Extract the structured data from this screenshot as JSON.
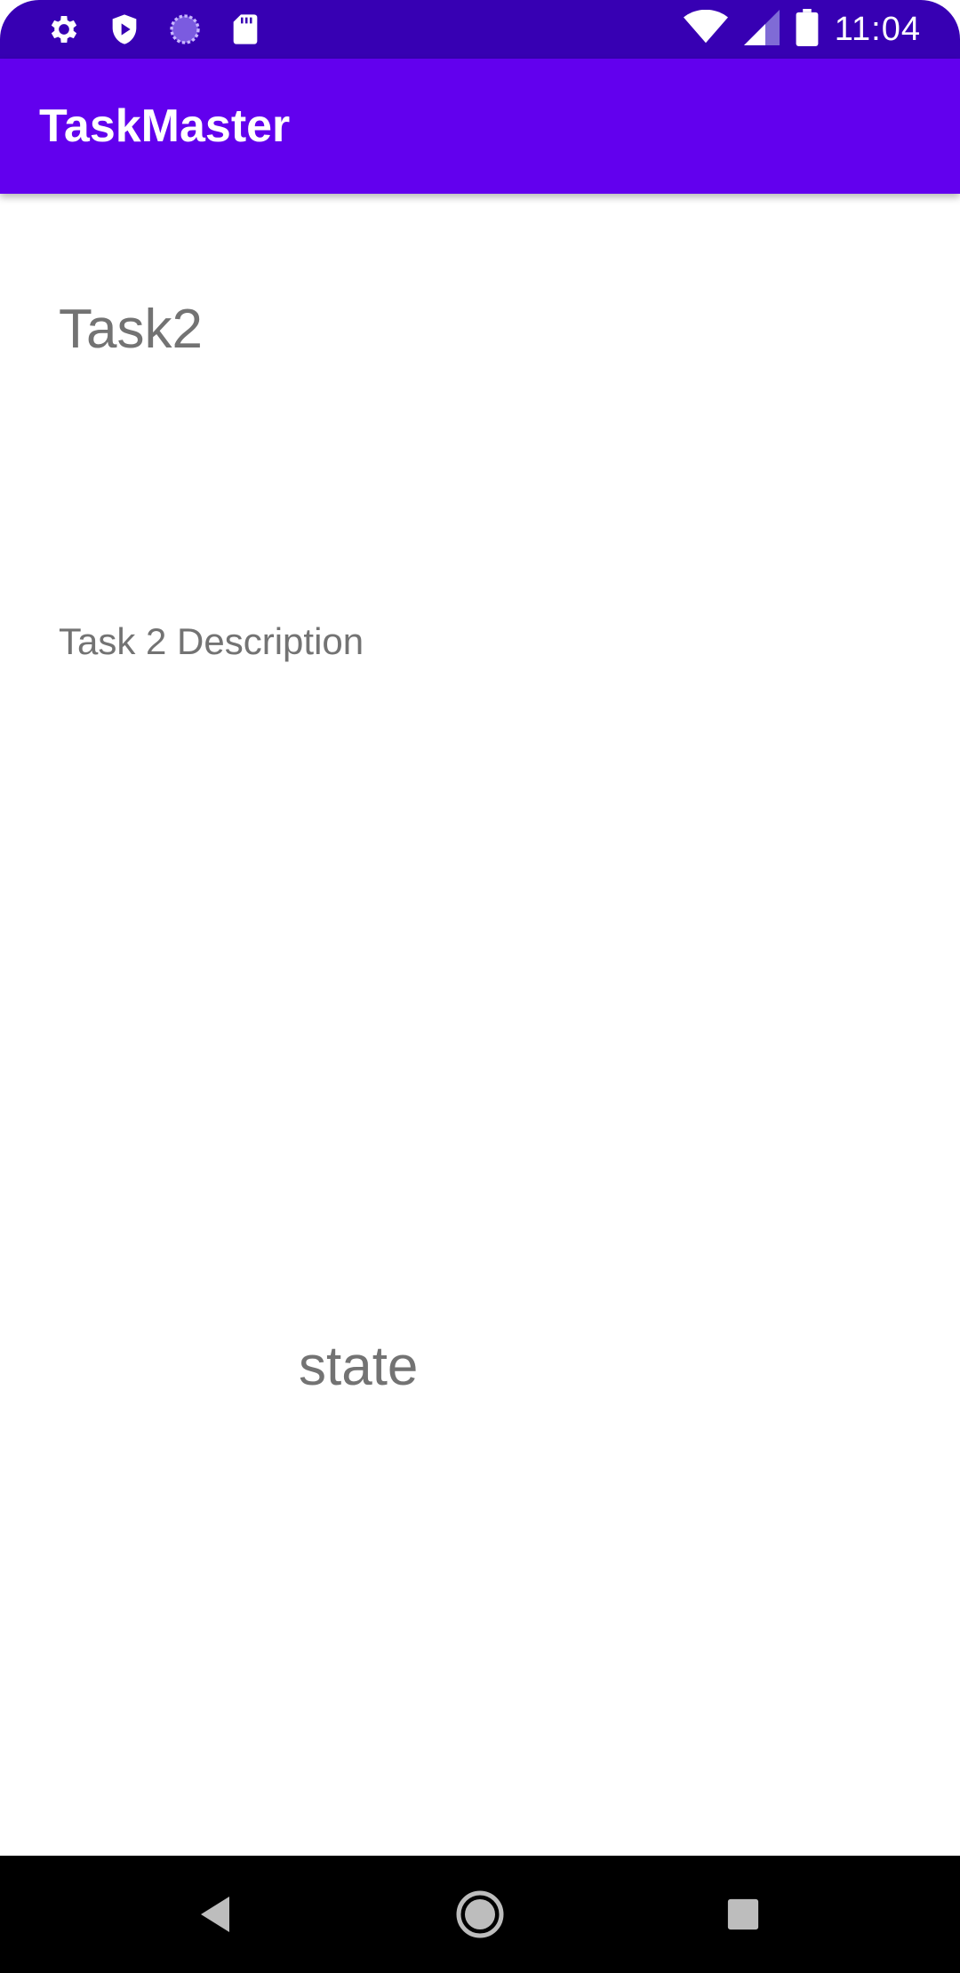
{
  "status_bar": {
    "time": "11:04",
    "left_icons": [
      "settings-gear-icon",
      "shield-play-icon",
      "loading-circle-icon",
      "sd-card-icon"
    ],
    "right_icons": [
      "wifi-icon",
      "cell-signal-icon",
      "battery-icon"
    ],
    "background_color": "#3700b3"
  },
  "app_bar": {
    "title": "TaskMaster",
    "background_color": "#6200ee"
  },
  "task": {
    "title": "Task2",
    "description": "Task 2  Description",
    "state": "state"
  },
  "nav_bar": {
    "buttons": [
      "back-icon",
      "home-icon",
      "recents-icon"
    ],
    "background_color": "#000000"
  }
}
